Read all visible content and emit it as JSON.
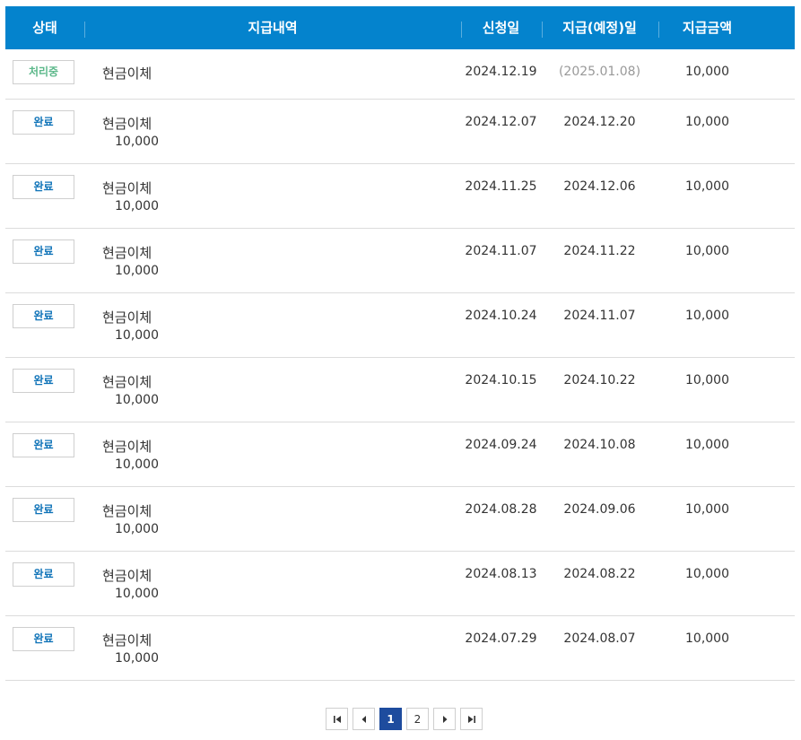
{
  "header": {
    "status": "상태",
    "details": "지급내역",
    "request_date": "신청일",
    "payment_date": "지급(예정)일",
    "amount": "지급금액"
  },
  "rows": [
    {
      "status": "처리중",
      "status_type": "processing",
      "method": "현금이체",
      "sub_amount": "",
      "request_date": "2024.12.19",
      "payment_date": "(2025.01.08)",
      "amount": "10,000"
    },
    {
      "status": "완료",
      "status_type": "done",
      "method": "현금이체",
      "sub_amount": "10,000",
      "request_date": "2024.12.07",
      "payment_date": "2024.12.20",
      "amount": "10,000"
    },
    {
      "status": "완료",
      "status_type": "done",
      "method": "현금이체",
      "sub_amount": "10,000",
      "request_date": "2024.11.25",
      "payment_date": "2024.12.06",
      "amount": "10,000"
    },
    {
      "status": "완료",
      "status_type": "done",
      "method": "현금이체",
      "sub_amount": "10,000",
      "request_date": "2024.11.07",
      "payment_date": "2024.11.22",
      "amount": "10,000"
    },
    {
      "status": "완료",
      "status_type": "done",
      "method": "현금이체",
      "sub_amount": "10,000",
      "request_date": "2024.10.24",
      "payment_date": "2024.11.07",
      "amount": "10,000"
    },
    {
      "status": "완료",
      "status_type": "done",
      "method": "현금이체",
      "sub_amount": "10,000",
      "request_date": "2024.10.15",
      "payment_date": "2024.10.22",
      "amount": "10,000"
    },
    {
      "status": "완료",
      "status_type": "done",
      "method": "현금이체",
      "sub_amount": "10,000",
      "request_date": "2024.09.24",
      "payment_date": "2024.10.08",
      "amount": "10,000"
    },
    {
      "status": "완료",
      "status_type": "done",
      "method": "현금이체",
      "sub_amount": "10,000",
      "request_date": "2024.08.28",
      "payment_date": "2024.09.06",
      "amount": "10,000"
    },
    {
      "status": "완료",
      "status_type": "done",
      "method": "현금이체",
      "sub_amount": "10,000",
      "request_date": "2024.08.13",
      "payment_date": "2024.08.22",
      "amount": "10,000"
    },
    {
      "status": "완료",
      "status_type": "done",
      "method": "현금이체",
      "sub_amount": "10,000",
      "request_date": "2024.07.29",
      "payment_date": "2024.08.07",
      "amount": "10,000"
    }
  ],
  "pagination": {
    "first_icon": "first-page-icon",
    "prev_icon": "prev-page-icon",
    "next_icon": "next-page-icon",
    "last_icon": "last-page-icon",
    "pages": [
      "1",
      "2"
    ],
    "current": "1"
  },
  "colors": {
    "header_bg": "#0483cd",
    "done_text": "#0f73b8",
    "processing_text": "#5cb88a",
    "active_page": "#1e4c9e"
  }
}
